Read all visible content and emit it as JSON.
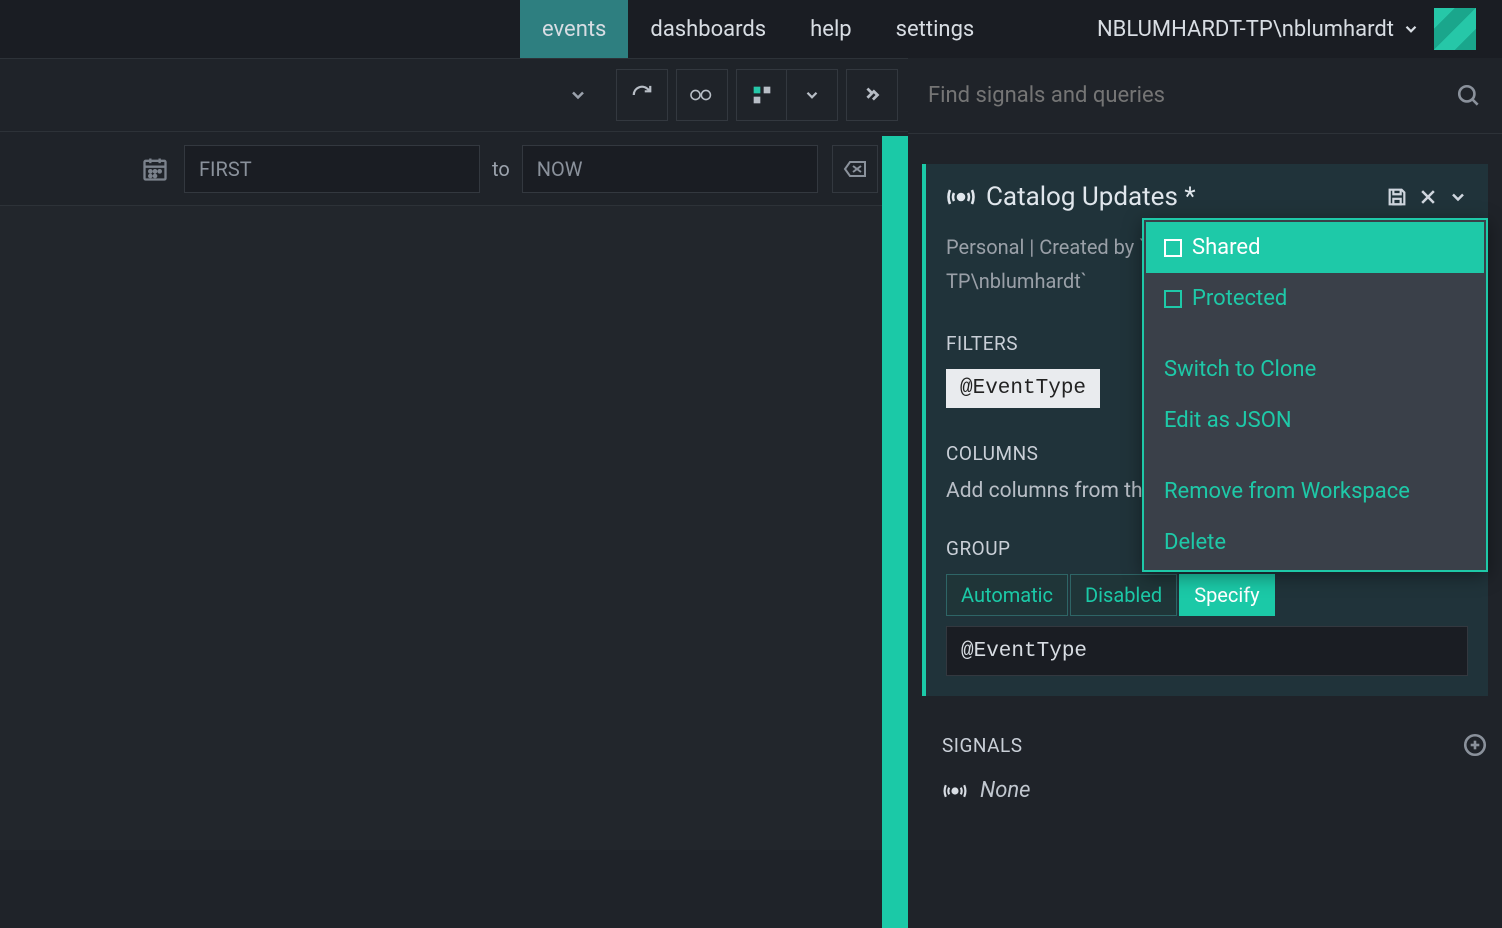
{
  "nav": {
    "items": [
      "events",
      "dashboards",
      "help",
      "settings"
    ],
    "active": "events",
    "user": "NBLUMHARDT-TP\\nblumhardt"
  },
  "time": {
    "from": "FIRST",
    "to_label": "to",
    "to": "NOW"
  },
  "side": {
    "search_placeholder": "Find signals and queries",
    "signal_title": "Catalog Updates *",
    "meta_line1": "Personal | Created by `NBLUMHARDT-",
    "meta_line2": "TP\\nblumhardt`",
    "filters_label": "FILTERS",
    "filter_value": "@EventType",
    "columns_label": "COLUMNS",
    "columns_text": "Add columns from the event list…",
    "group_label": "GROUP",
    "group_options": {
      "auto": "Automatic",
      "disabled": "Disabled",
      "specify": "Specify"
    },
    "group_value": "@EventType",
    "signals_label": "SIGNALS",
    "signals_none": "None"
  },
  "menu": {
    "shared": "Shared",
    "protected": "Protected",
    "switch": "Switch to Clone",
    "edit_json": "Edit as JSON",
    "remove": "Remove from Workspace",
    "delete": "Delete"
  }
}
